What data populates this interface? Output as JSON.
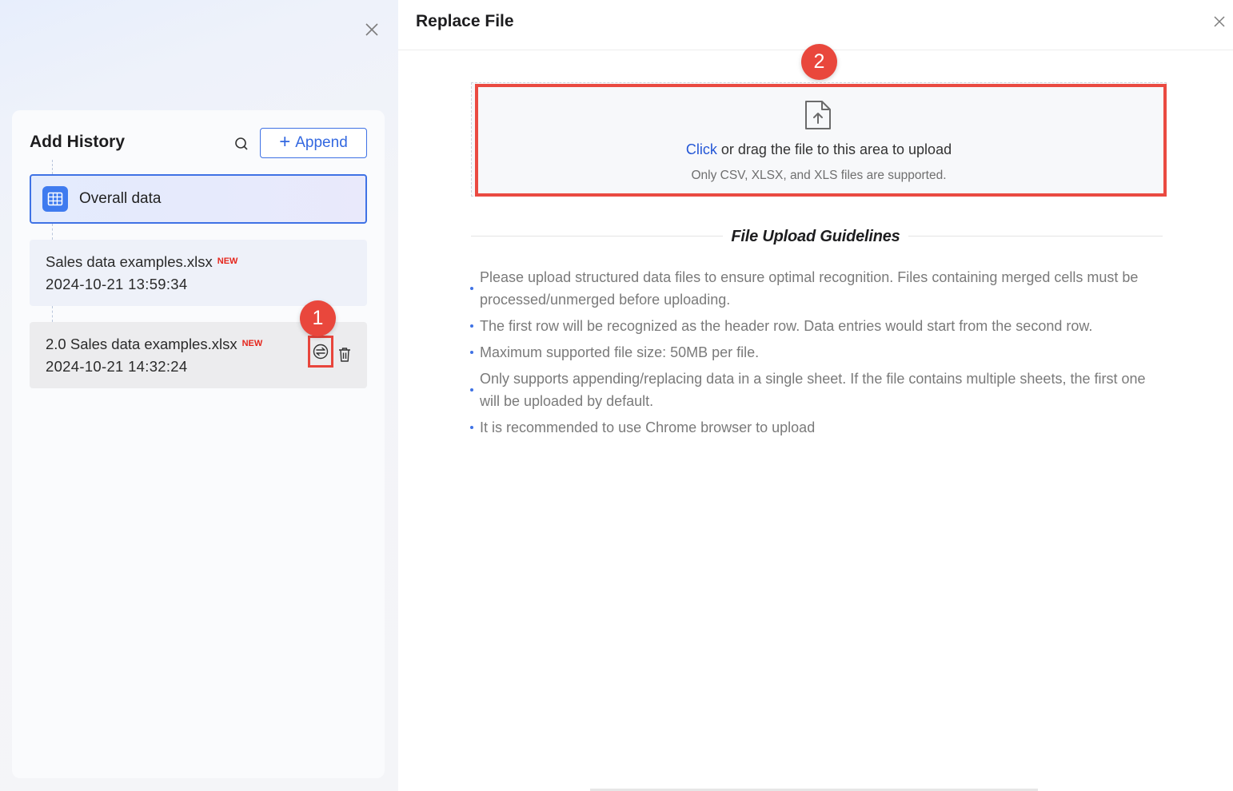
{
  "left_panel": {
    "title": "Add History",
    "append_label": "Append",
    "overall_label": "Overall data",
    "files": [
      {
        "name": "Sales data examples.xlsx",
        "badge": "NEW",
        "timestamp": "2024-10-21 13:59:34"
      },
      {
        "name": "2.0 Sales data examples.xlsx",
        "badge": "NEW",
        "timestamp": "2024-10-21 14:32:24"
      }
    ]
  },
  "right_panel": {
    "title": "Replace File",
    "upload": {
      "click_label": "Click",
      "main_text": " or drag the file to this area to upload",
      "sub_text": "Only CSV, XLSX, and XLS files are supported."
    },
    "guidelines_title": "File Upload Guidelines",
    "guidelines": [
      "Please upload structured data files to ensure optimal recognition. Files containing merged cells must be processed/unmerged before uploading.",
      "The first row will be recognized as the header row. Data entries would start from the second row.",
      "Maximum supported file size: 50MB per file.",
      "Only supports appending/replacing data in a single sheet. If the file contains multiple sheets, the first one will be uploaded by default.",
      "It is recommended to use Chrome browser to upload"
    ]
  },
  "annotations": {
    "step1": "1",
    "step2": "2"
  },
  "colors": {
    "accent": "#3f72e5",
    "highlight_red": "#ea4a41",
    "new_badge": "#e5261c"
  }
}
